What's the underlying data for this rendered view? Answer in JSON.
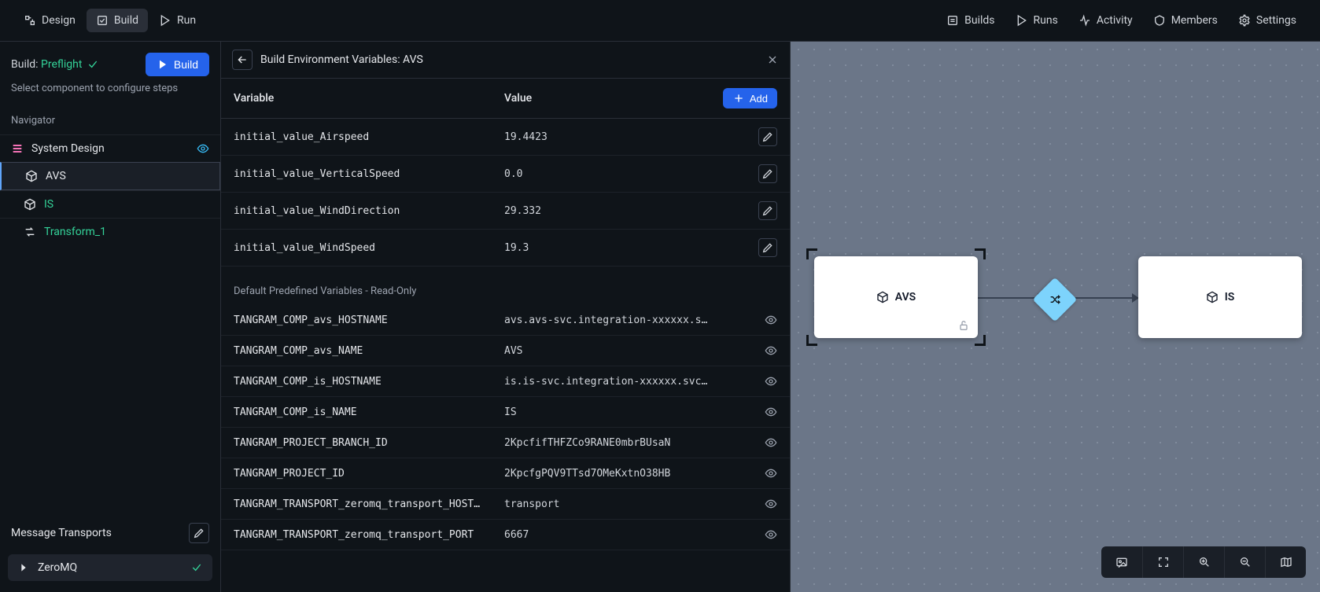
{
  "topbar": {
    "left": [
      {
        "label": "Design",
        "icon": "design-icon",
        "active": false
      },
      {
        "label": "Build",
        "icon": "build-icon",
        "active": true
      },
      {
        "label": "Run",
        "icon": "run-icon",
        "active": false
      }
    ],
    "right": [
      {
        "label": "Builds",
        "icon": "builds-icon"
      },
      {
        "label": "Runs",
        "icon": "runs-icon"
      },
      {
        "label": "Activity",
        "icon": "activity-icon"
      },
      {
        "label": "Members",
        "icon": "members-icon"
      },
      {
        "label": "Settings",
        "icon": "settings-icon"
      }
    ]
  },
  "sidebar": {
    "build_label": "Build:",
    "build_status": "Preflight",
    "build_button": "Build",
    "subtext": "Select component to configure steps",
    "navigator_title": "Navigator",
    "root": {
      "label": "System Design"
    },
    "items": [
      {
        "label": "AVS",
        "selected": true,
        "green": false
      },
      {
        "label": "IS",
        "selected": false,
        "green": true
      },
      {
        "label": "Transform_1",
        "selected": false,
        "green": true
      }
    ],
    "message_transports_title": "Message Transports",
    "transports": [
      {
        "label": "ZeroMQ"
      }
    ]
  },
  "panel": {
    "title": "Build Environment Variables: AVS",
    "col_variable": "Variable",
    "col_value": "Value",
    "add_label": "Add",
    "editable": [
      {
        "name": "initial_value_Airspeed",
        "value": "19.4423"
      },
      {
        "name": "initial_value_VerticalSpeed",
        "value": "0.0"
      },
      {
        "name": "initial_value_WindDirection",
        "value": "29.332"
      },
      {
        "name": "initial_value_WindSpeed",
        "value": "19.3"
      }
    ],
    "readonly_title": "Default Predefined Variables - Read-Only",
    "readonly": [
      {
        "name": "TANGRAM_COMP_avs_HOSTNAME",
        "value": "avs.avs-svc.integration-xxxxxx.s…"
      },
      {
        "name": "TANGRAM_COMP_avs_NAME",
        "value": "AVS"
      },
      {
        "name": "TANGRAM_COMP_is_HOSTNAME",
        "value": "is.is-svc.integration-xxxxxx.svc…"
      },
      {
        "name": "TANGRAM_COMP_is_NAME",
        "value": "IS"
      },
      {
        "name": "TANGRAM_PROJECT_BRANCH_ID",
        "value": "2KpcfifTHFZCo9RANE0mbrBUsaN"
      },
      {
        "name": "TANGRAM_PROJECT_ID",
        "value": "2KpcfgPQV9TTsd7OMeKxtnO38HB"
      },
      {
        "name": "TANGRAM_TRANSPORT_zeromq_transport_HOST…",
        "value": "transport"
      },
      {
        "name": "TANGRAM_TRANSPORT_zeromq_transport_PORT",
        "value": "6667"
      }
    ]
  },
  "canvas": {
    "nodes": {
      "avs": "AVS",
      "is": "IS"
    }
  }
}
